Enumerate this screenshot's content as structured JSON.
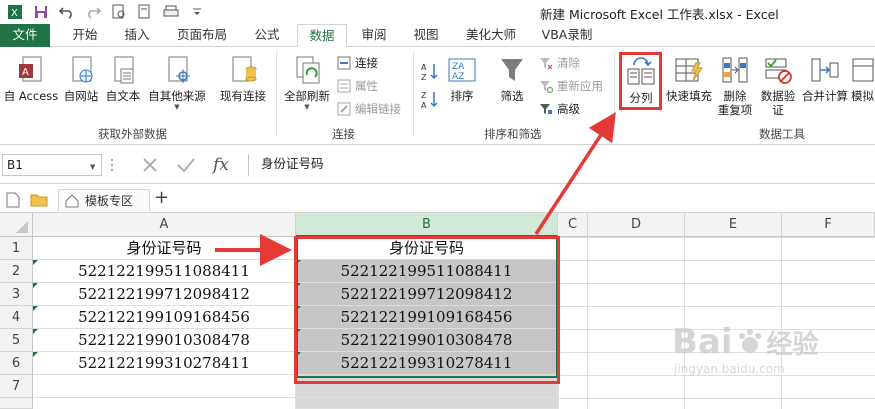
{
  "window": {
    "title": "新建 Microsoft Excel 工作表.xlsx - Excel"
  },
  "tabs": [
    {
      "label": "文件"
    },
    {
      "label": "开始"
    },
    {
      "label": "插入"
    },
    {
      "label": "页面布局"
    },
    {
      "label": "公式"
    },
    {
      "label": "数据"
    },
    {
      "label": "审阅"
    },
    {
      "label": "视图"
    },
    {
      "label": "美化大师"
    },
    {
      "label": "VBA录制"
    }
  ],
  "ribbon": {
    "get_external": {
      "group_label": "获取外部数据",
      "from_access": "自 Access",
      "from_web": "自网站",
      "from_text": "自文本",
      "from_other": "自其他来源",
      "existing_conn": "现有连接"
    },
    "connections": {
      "group_label": "连接",
      "refresh_all": "全部刷新",
      "connections": "连接",
      "properties": "属性",
      "edit_links": "编辑链接"
    },
    "sort_filter": {
      "group_label": "排序和筛选",
      "sort": "排序",
      "filter": "筛选",
      "clear": "清除",
      "reapply": "重新应用",
      "advanced": "高级"
    },
    "data_tools": {
      "group_label": "数据工具",
      "text_to_columns": "分列",
      "flash_fill": "快速填充",
      "remove_dup_1": "删除",
      "remove_dup_2": "重复项",
      "validation_1": "数据验",
      "validation_2": "证",
      "consolidate": "合并计算",
      "whatif": "模拟"
    }
  },
  "formula_bar": {
    "name_box": "B1",
    "fx": "fx",
    "content": "身份证号码"
  },
  "doc_tabs": {
    "template": "模板专区",
    "add": "+"
  },
  "grid": {
    "columns": [
      "A",
      "B",
      "C",
      "D",
      "E",
      "F"
    ],
    "rows": [
      "1",
      "2",
      "3",
      "4",
      "5",
      "6",
      "7"
    ],
    "colA": [
      "身份证号码",
      "522122199511088411",
      "522122199712098412",
      "522122199109168456",
      "522122199010308478",
      "522122199310278411"
    ],
    "colB": [
      "身份证号码",
      "522122199511088411",
      "522122199712098412",
      "522122199109168456",
      "522122199010308478",
      "522122199310278411"
    ]
  },
  "watermark": {
    "brand": "Bai",
    "brand2": "经验",
    "url": "jingyan.baidu.com"
  },
  "colors": {
    "excel_green": "#217346",
    "highlight_red": "#e53935",
    "selection_gray": "#c6c6c6"
  }
}
